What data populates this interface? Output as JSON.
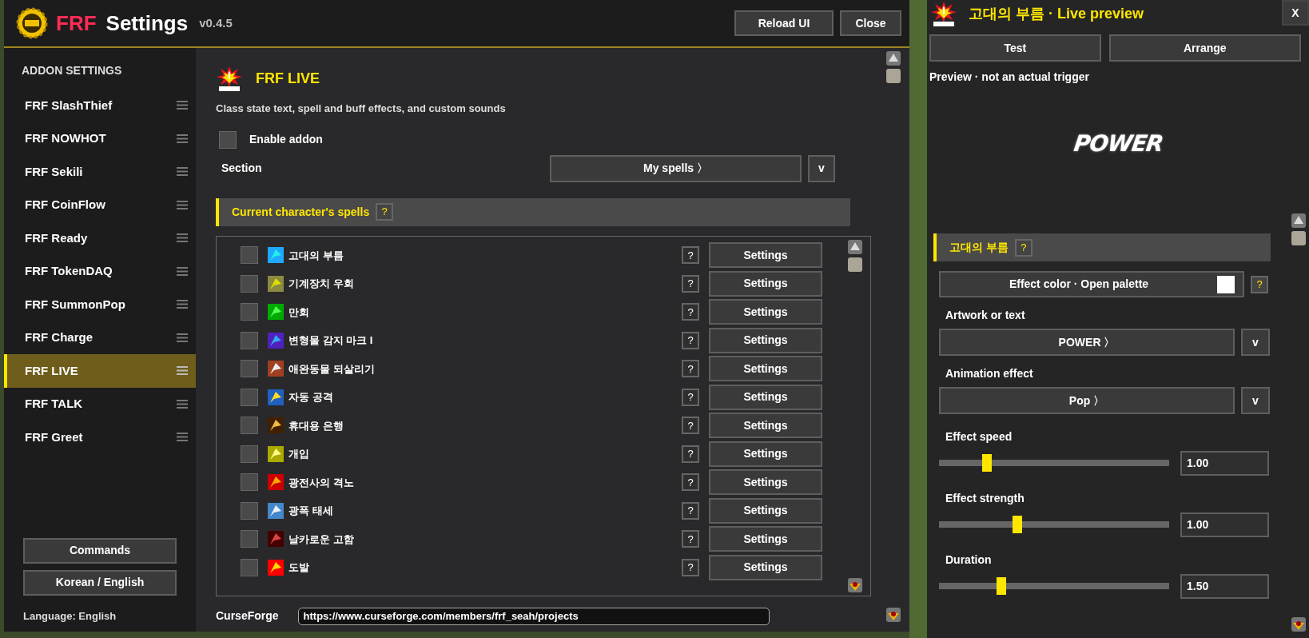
{
  "window": {
    "title_accent": "FRF",
    "title": "Settings",
    "version": "v0.4.5",
    "buttons": [
      "Reload UI",
      "Close"
    ]
  },
  "sidebar": {
    "heading": "ADDON SETTINGS",
    "items": [
      {
        "label": "FRF SlashThief",
        "selected": false
      },
      {
        "label": "FRF NOWHOT",
        "selected": false
      },
      {
        "label": "FRF Sekili",
        "selected": false
      },
      {
        "label": "FRF CoinFlow",
        "selected": false
      },
      {
        "label": "FRF Ready",
        "selected": false
      },
      {
        "label": "FRF TokenDAQ",
        "selected": false
      },
      {
        "label": "FRF SummonPop",
        "selected": false
      },
      {
        "label": "FRF Charge",
        "selected": false
      },
      {
        "label": "FRF LIVE",
        "selected": true
      },
      {
        "label": "FRF TALK",
        "selected": false
      },
      {
        "label": "FRF Greet",
        "selected": false
      }
    ],
    "buttons": [
      "Commands",
      "Korean / English"
    ],
    "language": "Language: English"
  },
  "content": {
    "title": "FRF LIVE",
    "description": "Class state text, spell and buff effects, and custom sounds",
    "enable": {
      "label": "Enable addon",
      "checked": false
    },
    "section": {
      "label": "Section",
      "value": "My spells 〉",
      "toggle": "v"
    },
    "group": {
      "title": "Current character's spells",
      "help": "?"
    },
    "spells": [
      {
        "name": "고대의 부름",
        "checked": false,
        "help": "?",
        "button": "Settings"
      },
      {
        "name": "기계장치 우회",
        "checked": false,
        "help": "?",
        "button": "Settings"
      },
      {
        "name": "만회",
        "checked": false,
        "help": "?",
        "button": "Settings"
      },
      {
        "name": "변형물 감지 마크 I",
        "checked": false,
        "help": "?",
        "button": "Settings"
      },
      {
        "name": "애완동물 되살리기",
        "checked": false,
        "help": "?",
        "button": "Settings"
      },
      {
        "name": "자동 공격",
        "checked": false,
        "help": "?",
        "button": "Settings"
      },
      {
        "name": "휴대용 은행",
        "checked": false,
        "help": "?",
        "button": "Settings"
      },
      {
        "name": "개입",
        "checked": false,
        "help": "?",
        "button": "Settings"
      },
      {
        "name": "광전사의 격노",
        "checked": false,
        "help": "?",
        "button": "Settings"
      },
      {
        "name": "광폭 태세",
        "checked": false,
        "help": "?",
        "button": "Settings"
      },
      {
        "name": "날카로운 고함",
        "checked": false,
        "help": "?",
        "button": "Settings"
      },
      {
        "name": "도발",
        "checked": false,
        "help": "?",
        "button": "Settings"
      }
    ],
    "footer": {
      "label": "CurseForge",
      "url": "https://www.curseforge.com/members/frf_seah/projects"
    }
  },
  "preview": {
    "title": "고대의 부름 · Live preview",
    "close": "X",
    "buttons": [
      "Test",
      "Arrange"
    ],
    "note": "Preview · not an actual trigger",
    "artwork_text": "POWER",
    "group": {
      "title": "고대의 부름",
      "help": "?"
    },
    "color_button": {
      "label": "Effect color · Open palette",
      "color": "#ffffff",
      "help": "?"
    },
    "fields": [
      {
        "kind": "dropdown",
        "label": "Artwork or text",
        "value": "POWER 〉",
        "toggle": "v"
      },
      {
        "kind": "dropdown",
        "label": "Animation effect",
        "value": "Pop 〉",
        "toggle": "v"
      },
      {
        "kind": "slider",
        "label": "Effect speed",
        "level": 0.21,
        "reading": "1.00"
      },
      {
        "kind": "slider",
        "label": "Effect strength",
        "level": 0.34,
        "reading": "1.00"
      },
      {
        "kind": "slider",
        "label": "Duration",
        "level": 0.27,
        "reading": "1.50"
      }
    ]
  }
}
